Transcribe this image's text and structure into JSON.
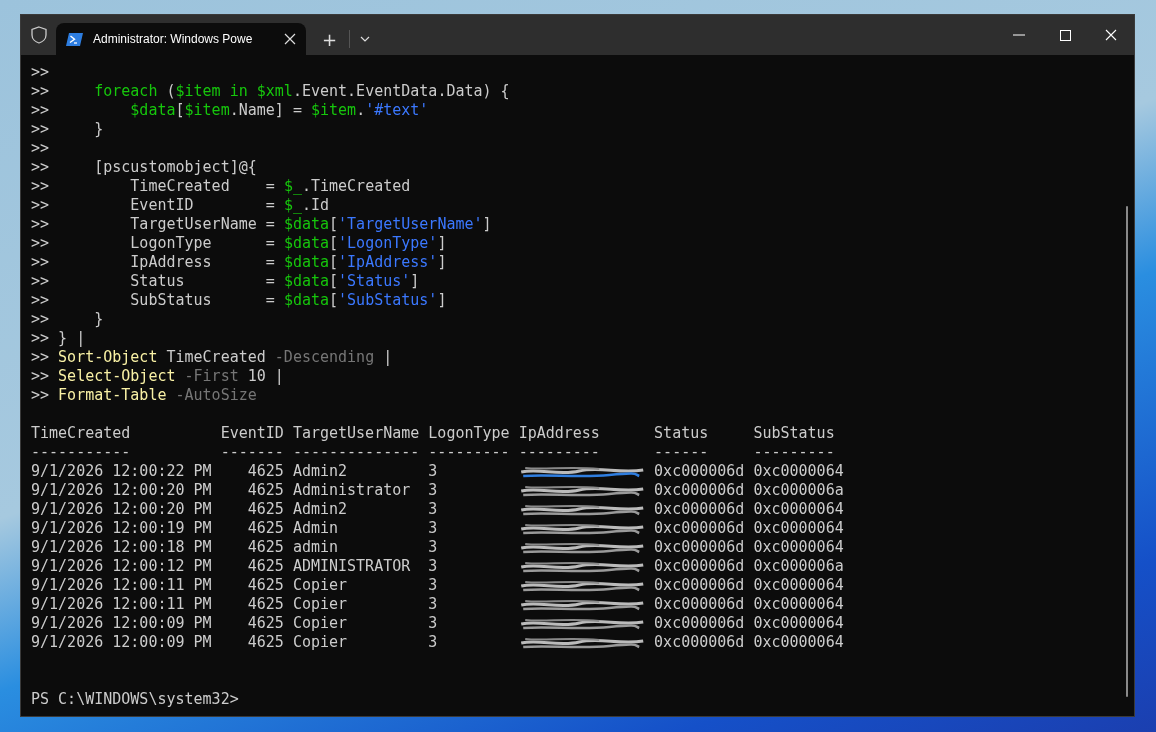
{
  "window": {
    "tab_title": "Administrator: Windows Powe",
    "new_tab": "+"
  },
  "code_lines": [
    [
      {
        "kind": "plain",
        "text": ">>"
      }
    ],
    [
      {
        "kind": "plain",
        "text": ">>     "
      },
      {
        "kind": "variable",
        "text": "foreach"
      },
      {
        "kind": "plain",
        "text": " ("
      },
      {
        "kind": "variable",
        "text": "$item in $xml"
      },
      {
        "kind": "plain",
        "text": ".Event.EventData.Data) {"
      }
    ],
    [
      {
        "kind": "plain",
        "text": ">>         "
      },
      {
        "kind": "variable",
        "text": "$data"
      },
      {
        "kind": "plain",
        "text": "["
      },
      {
        "kind": "variable",
        "text": "$item"
      },
      {
        "kind": "plain",
        "text": ".Name] = "
      },
      {
        "kind": "variable",
        "text": "$item"
      },
      {
        "kind": "plain",
        "text": "."
      },
      {
        "kind": "string",
        "text": "'#text'"
      }
    ],
    [
      {
        "kind": "plain",
        "text": ">>     }"
      }
    ],
    [
      {
        "kind": "plain",
        "text": ">>"
      }
    ],
    [
      {
        "kind": "plain",
        "text": ">>     [pscustomobject]@{"
      }
    ],
    [
      {
        "kind": "plain",
        "text": ">>         TimeCreated    = "
      },
      {
        "kind": "variable",
        "text": "$_"
      },
      {
        "kind": "plain",
        "text": ".TimeCreated"
      }
    ],
    [
      {
        "kind": "plain",
        "text": ">>         EventID        = "
      },
      {
        "kind": "variable",
        "text": "$_"
      },
      {
        "kind": "plain",
        "text": ".Id"
      }
    ],
    [
      {
        "kind": "plain",
        "text": ">>         TargetUserName = "
      },
      {
        "kind": "variable",
        "text": "$data"
      },
      {
        "kind": "plain",
        "text": "["
      },
      {
        "kind": "string",
        "text": "'TargetUserName'"
      },
      {
        "kind": "plain",
        "text": "]"
      }
    ],
    [
      {
        "kind": "plain",
        "text": ">>         LogonType      = "
      },
      {
        "kind": "variable",
        "text": "$data"
      },
      {
        "kind": "plain",
        "text": "["
      },
      {
        "kind": "string",
        "text": "'LogonType'"
      },
      {
        "kind": "plain",
        "text": "]"
      }
    ],
    [
      {
        "kind": "plain",
        "text": ">>         IpAddress      = "
      },
      {
        "kind": "variable",
        "text": "$data"
      },
      {
        "kind": "plain",
        "text": "["
      },
      {
        "kind": "string",
        "text": "'IpAddress'"
      },
      {
        "kind": "plain",
        "text": "]"
      }
    ],
    [
      {
        "kind": "plain",
        "text": ">>         Status         = "
      },
      {
        "kind": "variable",
        "text": "$data"
      },
      {
        "kind": "plain",
        "text": "["
      },
      {
        "kind": "string",
        "text": "'Status'"
      },
      {
        "kind": "plain",
        "text": "]"
      }
    ],
    [
      {
        "kind": "plain",
        "text": ">>         SubStatus      = "
      },
      {
        "kind": "variable",
        "text": "$data"
      },
      {
        "kind": "plain",
        "text": "["
      },
      {
        "kind": "string",
        "text": "'SubStatus'"
      },
      {
        "kind": "plain",
        "text": "]"
      }
    ],
    [
      {
        "kind": "plain",
        "text": ">>     }"
      }
    ],
    [
      {
        "kind": "plain",
        "text": ">> } |"
      }
    ],
    [
      {
        "kind": "plain",
        "text": ">> "
      },
      {
        "kind": "command",
        "text": "Sort-Object"
      },
      {
        "kind": "plain",
        "text": " TimeCreated "
      },
      {
        "kind": "parameter",
        "text": "-Descending"
      },
      {
        "kind": "plain",
        "text": " |"
      }
    ],
    [
      {
        "kind": "plain",
        "text": ">> "
      },
      {
        "kind": "command",
        "text": "Select-Object"
      },
      {
        "kind": "parameter",
        "text": " -First"
      },
      {
        "kind": "plain",
        "text": " 10 |"
      }
    ],
    [
      {
        "kind": "plain",
        "text": ">> "
      },
      {
        "kind": "command",
        "text": "Format-Table"
      },
      {
        "kind": "parameter",
        "text": " -AutoSize"
      }
    ]
  ],
  "table": {
    "columns": [
      "TimeCreated",
      "EventID",
      "TargetUserName",
      "LogonType",
      "IpAddress",
      "Status",
      "SubStatus"
    ],
    "rules": [
      "-----------",
      "-------",
      "--------------",
      "---------",
      "---------",
      "------",
      "---------"
    ],
    "rows": [
      {
        "time": "9/1/2026 12:00:22 PM",
        "event_id": "4625",
        "user": "Admin2",
        "logon_type": "3",
        "ip": {
          "kind": "redacted"
        },
        "status": "0xc000006d",
        "sub_status": "0xc0000064"
      },
      {
        "time": "9/1/2026 12:00:20 PM",
        "event_id": "4625",
        "user": "Administrator",
        "logon_type": "3",
        "ip": {
          "kind": "redacted"
        },
        "status": "0xc000006d",
        "sub_status": "0xc000006a"
      },
      {
        "time": "9/1/2026 12:00:20 PM",
        "event_id": "4625",
        "user": "Admin2",
        "logon_type": "3",
        "ip": {
          "kind": "redacted"
        },
        "status": "0xc000006d",
        "sub_status": "0xc0000064"
      },
      {
        "time": "9/1/2026 12:00:19 PM",
        "event_id": "4625",
        "user": "Admin",
        "logon_type": "3",
        "ip": {
          "kind": "redacted"
        },
        "status": "0xc000006d",
        "sub_status": "0xc0000064"
      },
      {
        "time": "9/1/2026 12:00:18 PM",
        "event_id": "4625",
        "user": "admin",
        "logon_type": "3",
        "ip": {
          "kind": "redacted"
        },
        "status": "0xc000006d",
        "sub_status": "0xc0000064"
      },
      {
        "time": "9/1/2026 12:00:12 PM",
        "event_id": "4625",
        "user": "ADMINISTRATOR",
        "logon_type": "3",
        "ip": {
          "kind": "redacted"
        },
        "status": "0xc000006d",
        "sub_status": "0xc000006a"
      },
      {
        "time": "9/1/2026 12:00:11 PM",
        "event_id": "4625",
        "user": "Copier",
        "logon_type": "3",
        "ip": {
          "kind": "redacted"
        },
        "status": "0xc000006d",
        "sub_status": "0xc0000064"
      },
      {
        "time": "9/1/2026 12:00:11 PM",
        "event_id": "4625",
        "user": "Copier",
        "logon_type": "3",
        "ip": {
          "kind": "redacted"
        },
        "status": "0xc000006d",
        "sub_status": "0xc0000064"
      },
      {
        "time": "9/1/2026 12:00:09 PM",
        "event_id": "4625",
        "user": "Copier",
        "logon_type": "3",
        "ip": {
          "kind": "redacted"
        },
        "status": "0xc000006d",
        "sub_status": "0xc0000064"
      },
      {
        "time": "9/1/2026 12:00:09 PM",
        "event_id": "4625",
        "user": "Copier",
        "logon_type": "3",
        "ip": {
          "kind": "redacted"
        },
        "status": "0xc000006d",
        "sub_status": "0xc0000064"
      }
    ]
  },
  "prompt": "PS C:\\WINDOWS\\system32>"
}
